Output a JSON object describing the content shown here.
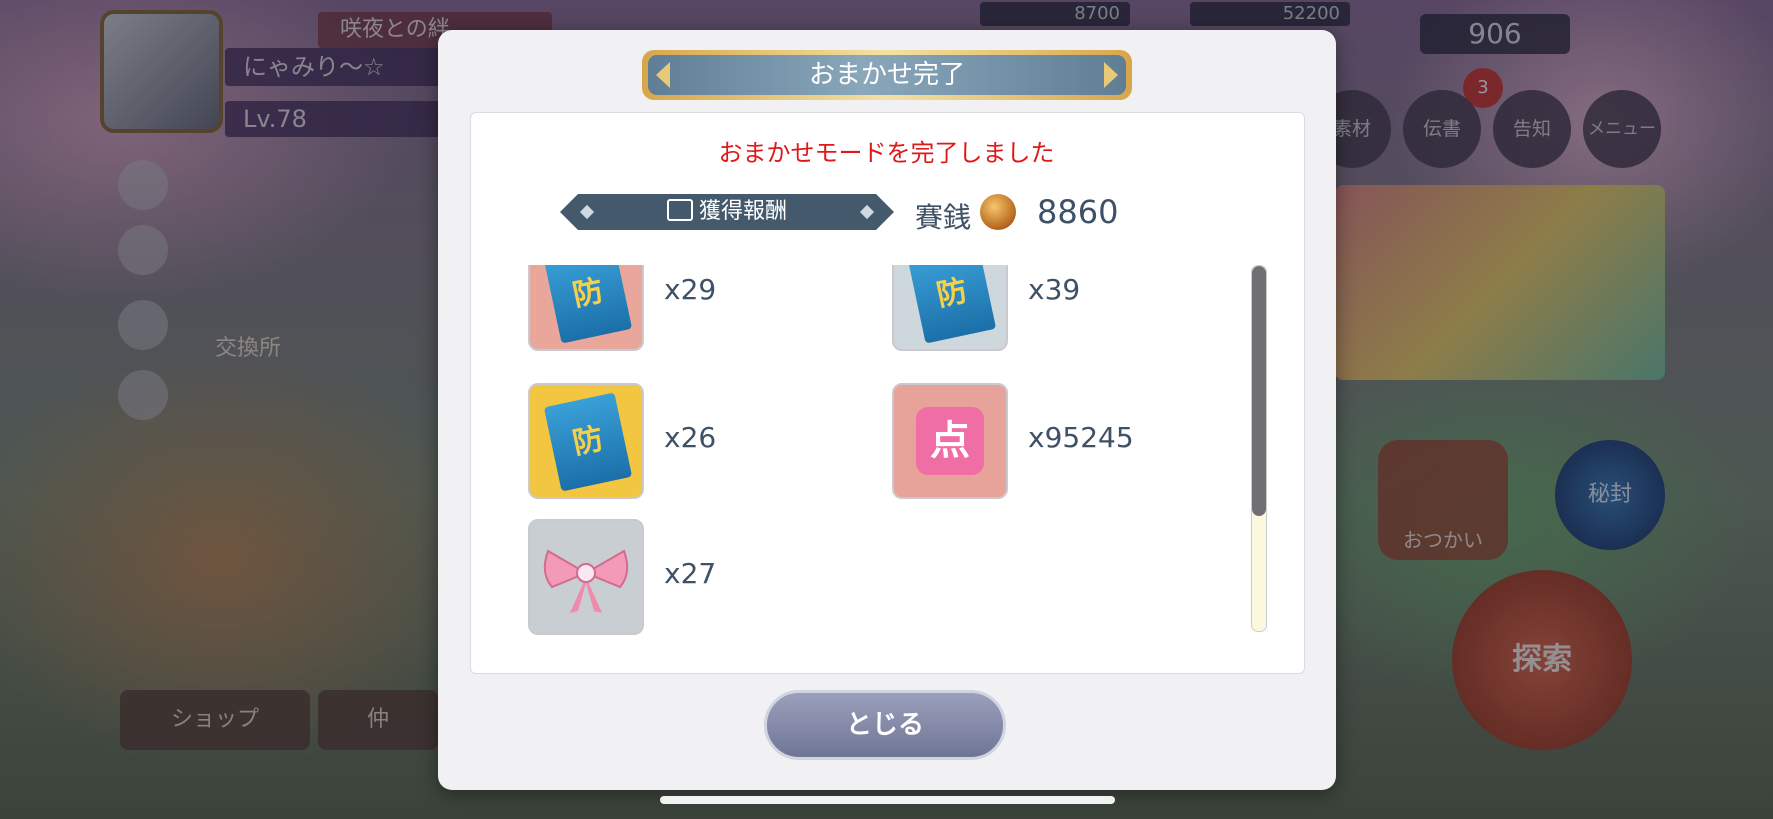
{
  "hud": {
    "friend_label": "咲夜との絆",
    "player_name": "にゃみり〜☆",
    "level": "Lv.78",
    "stat_max_1": "8700",
    "stat_max_2": "52200",
    "gem_count": "906",
    "notice_badge": "3",
    "menu": [
      "素材",
      "伝書",
      "告知",
      "メニュー"
    ],
    "exchange_label": "交換所",
    "shop_label": "ショップ",
    "friends_label": "仲",
    "errand_label": "おつかい",
    "seal_label": "秘封",
    "explore_label": "探索"
  },
  "modal": {
    "title": "おまかせ完了",
    "message": "おまかせモードを完了しました",
    "reward_heading": "獲得報酬",
    "coin_label": "賽銭",
    "coin_amount": "8860",
    "items": [
      {
        "icon": "defense-book-beginner-icon",
        "glyph": "防",
        "qty": "x29",
        "bg": "#e9a79b"
      },
      {
        "icon": "defense-book-intermediate-icon",
        "glyph": "防",
        "qty": "x39",
        "bg": "#cdd7dc"
      },
      {
        "icon": "defense-book-advanced-icon",
        "glyph": "防",
        "qty": "x26",
        "bg": "#f3c642"
      },
      {
        "icon": "points-icon",
        "glyph": "点",
        "qty": "x95245",
        "bg": "#e7a29a"
      },
      {
        "icon": "pink-ribbon-icon",
        "glyph": "",
        "qty": "x27",
        "bg": "#c9ced3"
      }
    ],
    "close_label": "とじる"
  }
}
